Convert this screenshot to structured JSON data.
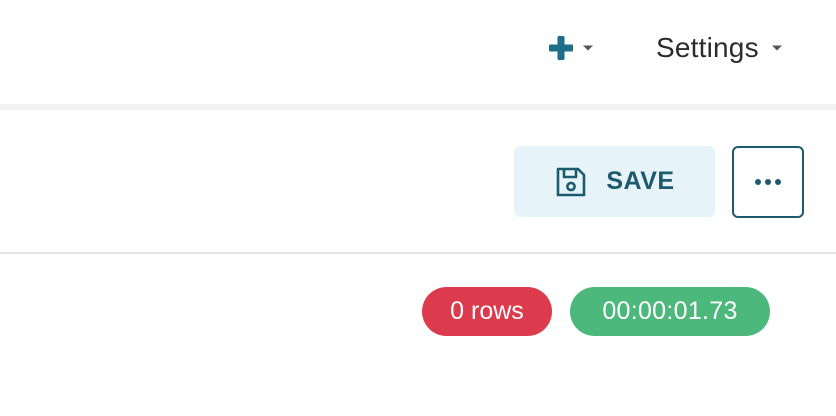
{
  "header": {
    "new_menu": {
      "icon": "plus-icon",
      "caret_icon": "caret-down-icon"
    },
    "settings_menu": {
      "label": "Settings",
      "caret_icon": "caret-down-icon"
    }
  },
  "toolbar": {
    "save_button": {
      "label": "SAVE",
      "icon": "save-icon"
    },
    "more_button": {
      "icon": "ellipsis-icon"
    }
  },
  "results": {
    "row_count": "0 rows",
    "elapsed_time": "00:00:01.73"
  },
  "colors": {
    "accent": "#1d5a6e",
    "save_bg": "#e6f4f9",
    "rows_badge": "#dc3a4d",
    "time_badge": "#4db87c"
  }
}
